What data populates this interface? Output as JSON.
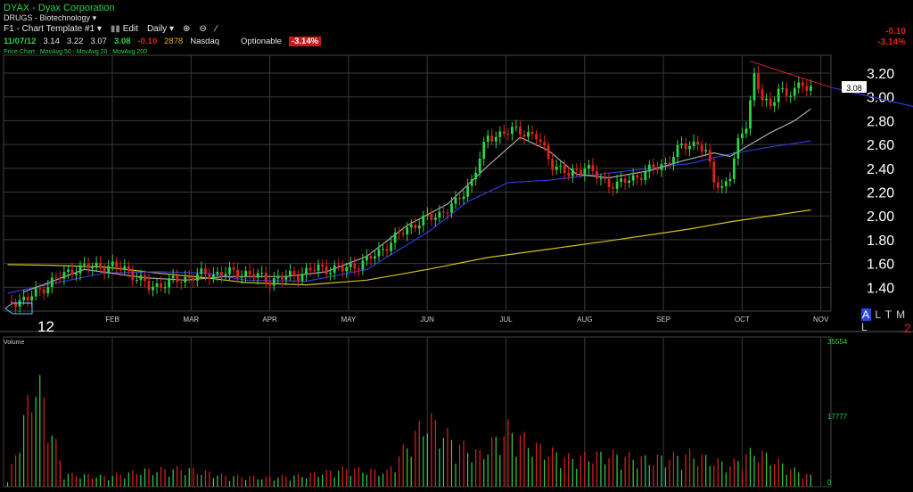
{
  "header": {
    "title": "DYAX - Dyax Corporation",
    "industry": "DRUGS - Biotechnology",
    "template": "F1 - Chart Template #1",
    "edit_label": "Edit",
    "period": "Daily"
  },
  "quote": {
    "date": "11/07/12",
    "open": "3.14",
    "high": "3.22",
    "low": "3.07",
    "close": "3.08",
    "change": "-0.10",
    "volume": "2878",
    "exchange": "Nasdaq",
    "optionable": "Optionable",
    "pct_change": "-3.14%"
  },
  "right_change": {
    "change": "-0.10",
    "pct": "-3.14%"
  },
  "studies_text": "Price Chart : MovAvg 50 : MovAvg 20 : MovAvg 200",
  "price_tag": "3.08",
  "year_label": "12",
  "scale_buttons": {
    "a": "A",
    "rest": "L T M L"
  },
  "red_two": ".2",
  "volume_label": "Volume",
  "colors": {
    "up": "#2fd24a",
    "down": "#e12121",
    "ma20": "#a9a9a9",
    "ma50": "#2f39d8",
    "ma200": "#d4c21f",
    "trendline": "#e12121"
  },
  "chart_data": {
    "type": "line",
    "title": "DYAX - Dyax Corporation",
    "x_tick_labels": [
      "FEB",
      "MAR",
      "APR",
      "MAY",
      "JUN",
      "JUL",
      "AUG",
      "SEP",
      "OCT",
      "NOV"
    ],
    "y_ticks": [
      "3.20",
      "3.00",
      "2.80",
      "2.60",
      "2.40",
      "2.20",
      "2.00",
      "1.80",
      "1.60",
      "1.40"
    ],
    "ylim": [
      1.2,
      3.35
    ],
    "volume_ticks": [
      "35554",
      "17777",
      "0"
    ],
    "volume_max": 35554,
    "series": [
      {
        "name": "MovAvg 200",
        "x": [
          1,
          12,
          25,
          38,
          50,
          60,
          75,
          90,
          105,
          120,
          135,
          150,
          160,
          170,
          180,
          200
        ],
        "values": [
          1.59,
          1.585,
          1.57,
          1.52,
          1.48,
          1.44,
          1.42,
          1.46,
          1.55,
          1.65,
          1.72,
          1.79,
          1.84,
          1.89,
          1.95,
          2.05
        ]
      },
      {
        "name": "MovAvg 50",
        "x": [
          1,
          12,
          25,
          38,
          50,
          60,
          75,
          90,
          105,
          115,
          125,
          135,
          150,
          160,
          170,
          180,
          190,
          200
        ],
        "values": [
          1.35,
          1.43,
          1.52,
          1.53,
          1.52,
          1.46,
          1.45,
          1.55,
          1.86,
          2.12,
          2.28,
          2.3,
          2.36,
          2.4,
          2.44,
          2.52,
          2.58,
          2.63
        ]
      },
      {
        "name": "MovAvg 20",
        "x": [
          5,
          20,
          35,
          45,
          55,
          70,
          80,
          90,
          100,
          110,
          120,
          128,
          135,
          142,
          150,
          160,
          168,
          176,
          180,
          186,
          190,
          196,
          200
        ],
        "values": [
          1.36,
          1.55,
          1.48,
          1.46,
          1.49,
          1.49,
          1.53,
          1.66,
          1.92,
          2.1,
          2.42,
          2.66,
          2.55,
          2.35,
          2.32,
          2.38,
          2.46,
          2.53,
          2.5,
          2.62,
          2.7,
          2.8,
          2.9
        ]
      }
    ],
    "price_segments": [
      {
        "x": [
          1,
          6,
          12,
          18,
          24,
          30,
          36,
          42,
          48,
          54,
          60,
          66,
          72,
          78,
          84,
          90,
          96,
          100,
          104,
          108,
          112,
          116,
          120,
          124,
          128,
          132,
          136,
          140,
          144,
          148,
          152,
          156,
          160,
          164,
          168,
          172,
          174,
          176,
          178,
          180,
          182,
          184,
          186,
          188,
          190,
          192,
          194,
          196,
          198,
          200
        ],
        "values": [
          1.28,
          1.3,
          1.45,
          1.56,
          1.58,
          1.56,
          1.4,
          1.45,
          1.5,
          1.52,
          1.52,
          1.46,
          1.5,
          1.56,
          1.55,
          1.62,
          1.78,
          1.9,
          1.96,
          2.02,
          2.1,
          2.3,
          2.66,
          2.7,
          2.72,
          2.66,
          2.44,
          2.34,
          2.42,
          2.3,
          2.26,
          2.32,
          2.38,
          2.44,
          2.58,
          2.62,
          2.52,
          2.3,
          2.24,
          2.34,
          2.6,
          2.78,
          3.18,
          2.98,
          2.9,
          3.1,
          3.0,
          3.05,
          3.12,
          3.08
        ]
      }
    ],
    "trendline": {
      "x": [
        185,
        205
      ],
      "values": [
        3.3,
        3.08
      ]
    },
    "volume": {
      "x": [
        1,
        8,
        15,
        25,
        35,
        45,
        55,
        65,
        75,
        85,
        95,
        105,
        112,
        118,
        125,
        132,
        140,
        150,
        160,
        170,
        180,
        186,
        190,
        195,
        200
      ],
      "values": [
        1200,
        31000,
        3500,
        2800,
        4500,
        5000,
        3000,
        2500,
        3200,
        5000,
        4000,
        19000,
        12000,
        9000,
        16000,
        11000,
        8000,
        9000,
        7500,
        9000,
        6000,
        10000,
        8000,
        5000,
        2878
      ]
    }
  }
}
